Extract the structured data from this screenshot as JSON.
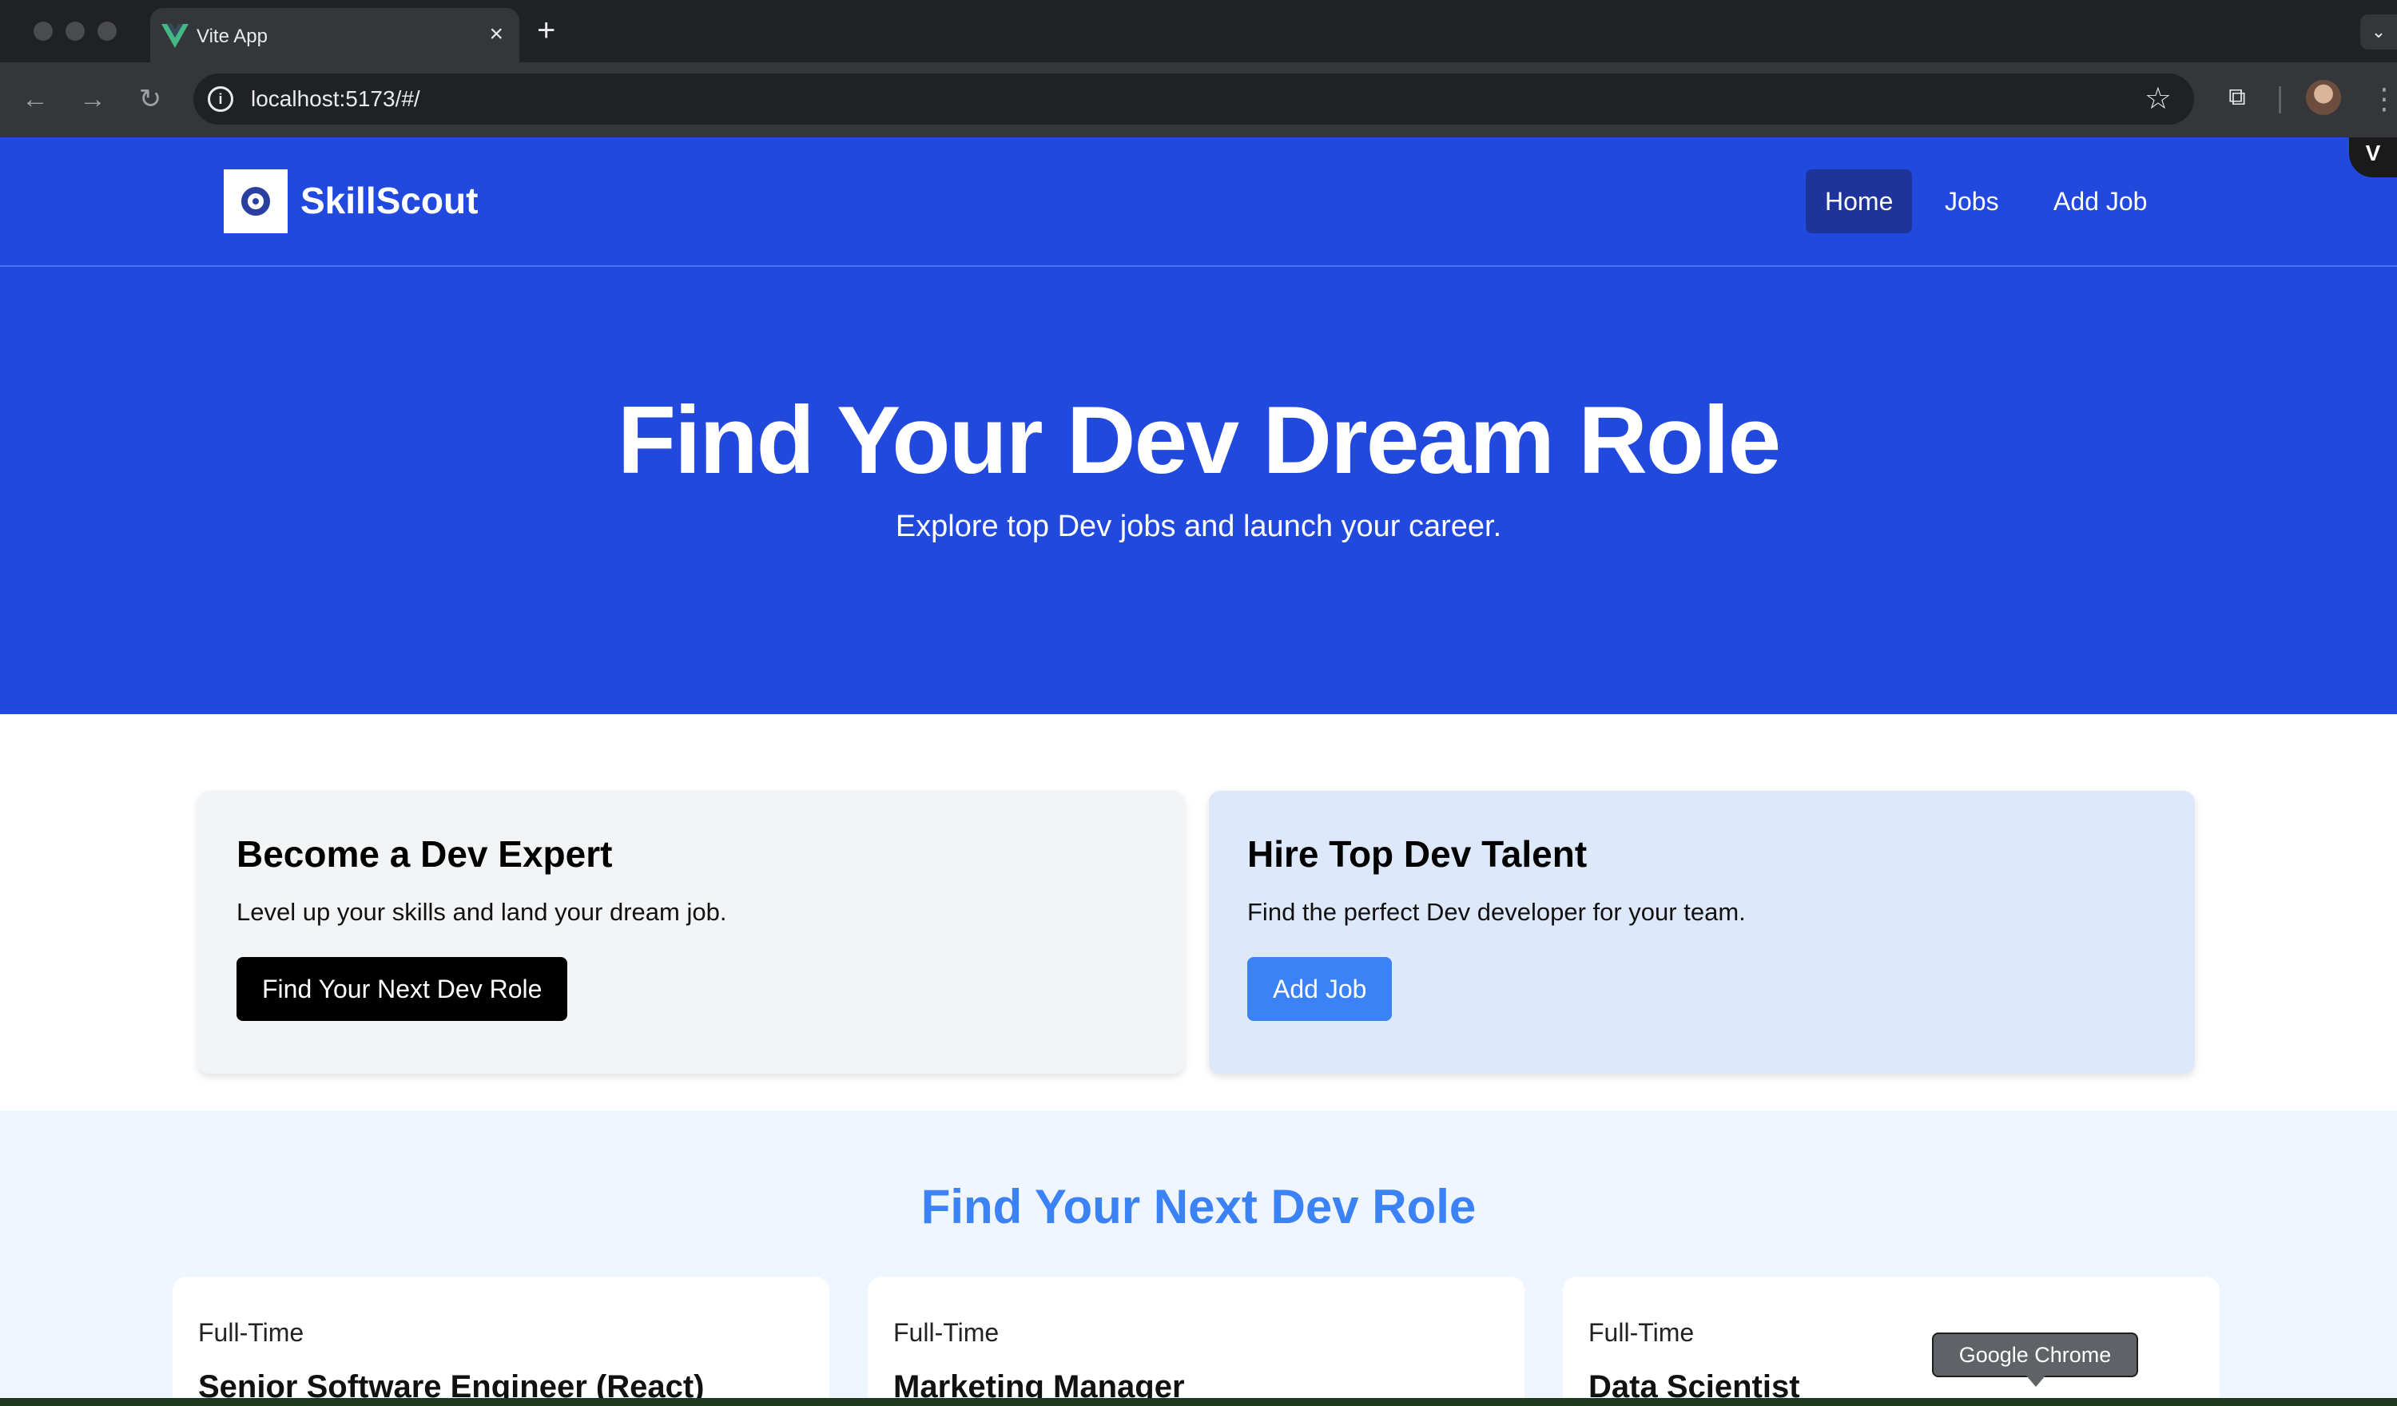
{
  "browser": {
    "tab_title": "Vite App",
    "tab_close": "×",
    "new_tab": "+",
    "url": "localhost:5173/#/",
    "tooltip": "Google Chrome",
    "devtools_badge": "V"
  },
  "navbar": {
    "brand": "SkillScout",
    "links": [
      {
        "label": "Home",
        "active": true
      },
      {
        "label": "Jobs",
        "active": false
      },
      {
        "label": "Add Job",
        "active": false
      }
    ]
  },
  "hero": {
    "title": "Find Your Dev Dream Role",
    "subtitle": "Explore top Dev jobs and launch your career."
  },
  "cards": [
    {
      "title": "Become a Dev Expert",
      "text": "Level up your skills and land your dream job.",
      "button": "Find Your Next Dev Role",
      "bg": "#f3f4f6",
      "button_color": "#000000"
    },
    {
      "title": "Hire Top Dev Talent",
      "text": "Find the perfect Dev developer for your team.",
      "button": "Add Job",
      "bg": "#dde8fb",
      "button_color": "#3b82f6"
    }
  ],
  "listings": {
    "title": "Find Your Next Dev Role",
    "jobs": [
      {
        "type": "Full-Time",
        "title": "Senior Software Engineer (React)"
      },
      {
        "type": "Full-Time",
        "title": "Marketing Manager"
      },
      {
        "type": "Full-Time",
        "title": "Data Scientist"
      }
    ]
  },
  "colors": {
    "primary": "#2249dd",
    "accent": "#3b82f6",
    "nav_active": "#1e349a"
  }
}
